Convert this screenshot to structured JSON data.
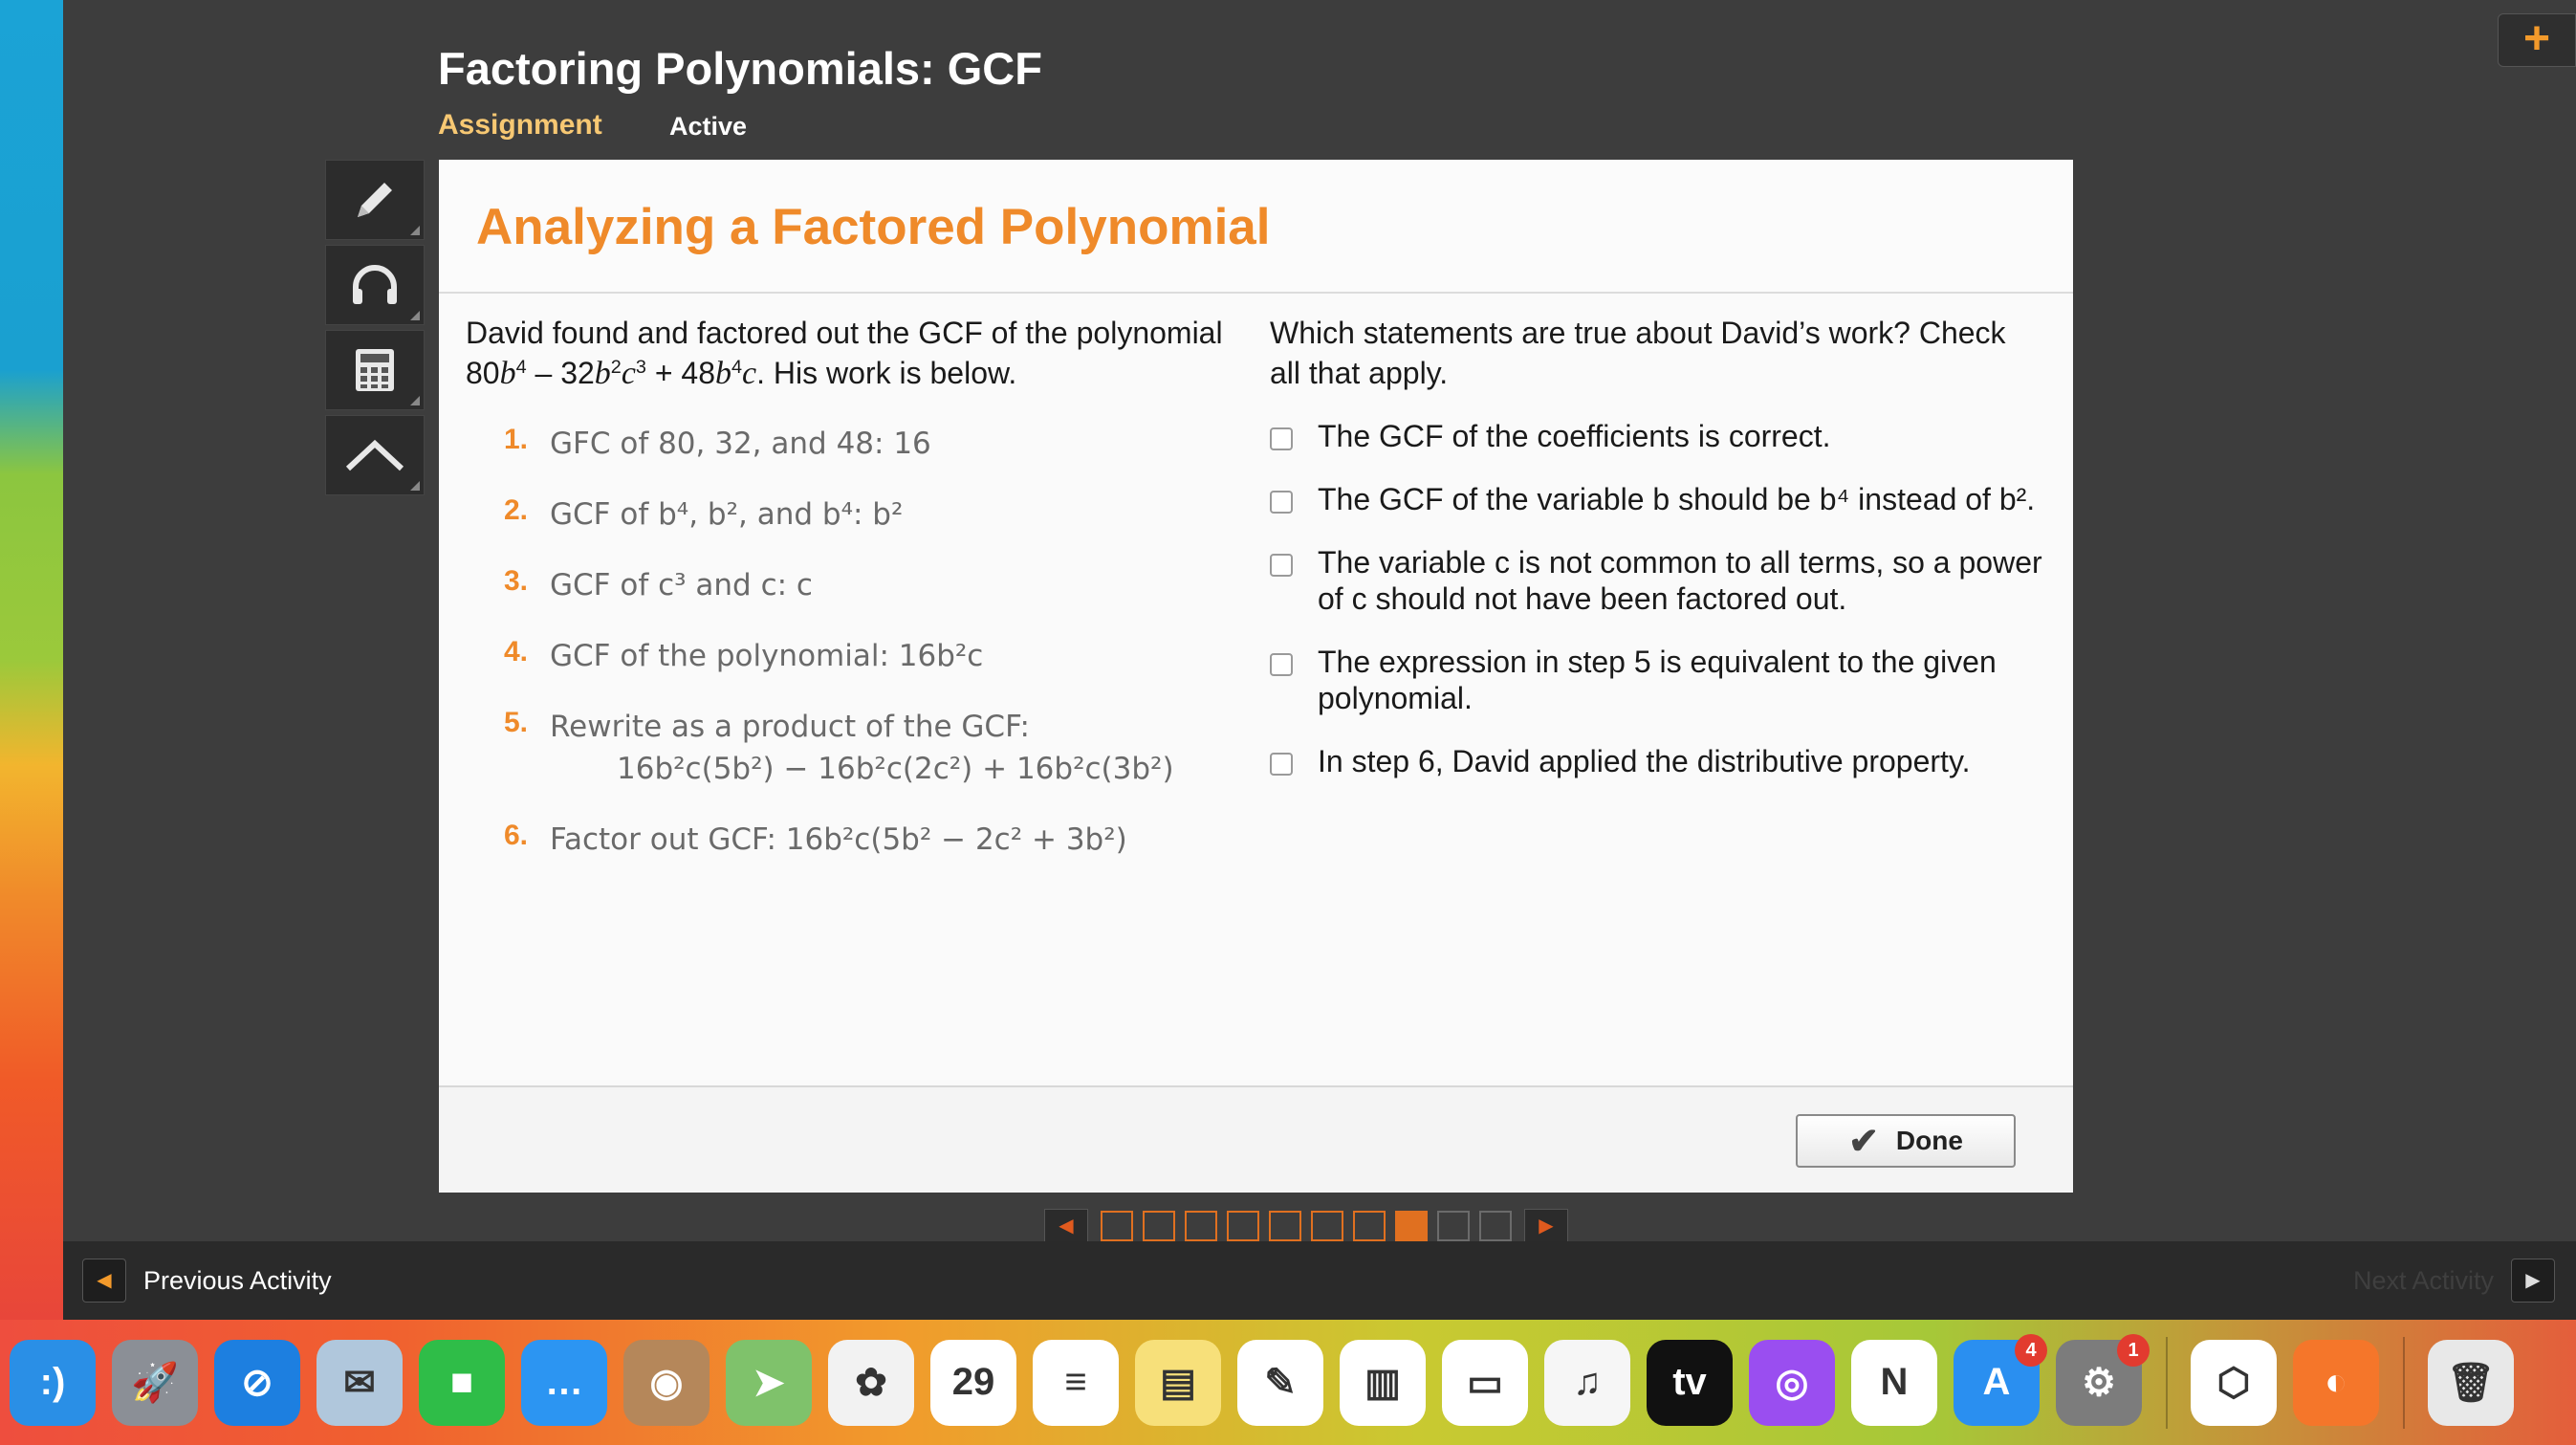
{
  "header": {
    "course_title": "Factoring Polynomials: GCF",
    "assignment_label": "Assignment",
    "status": "Active",
    "plus_label": "+"
  },
  "tools": [
    {
      "name": "pencil-icon"
    },
    {
      "name": "headphones-icon"
    },
    {
      "name": "calculator-icon"
    },
    {
      "name": "caret-up-icon"
    }
  ],
  "activity": {
    "title": "Analyzing a Factored Polynomial",
    "prompt_lead": "David found and factored out the GCF of the polynomial",
    "prompt_tail": ". His work is below.",
    "steps": [
      {
        "num": "1.",
        "text": "GFC of 80, 32, and 48: 16"
      },
      {
        "num": "2.",
        "text": "GCF of b⁴, b², and b⁴: b²"
      },
      {
        "num": "3.",
        "text": "GCF of c³ and c: c"
      },
      {
        "num": "4.",
        "text": "GCF of the polynomial: 16b²c"
      },
      {
        "num": "5.",
        "text": "Rewrite as a product of the GCF:",
        "sub": "16b²c(5b²) − 16b²c(2c²) + 16b²c(3b²)"
      },
      {
        "num": "6.",
        "text": "Factor out GCF: 16b²c(5b² − 2c² + 3b²)"
      }
    ],
    "question": "Which statements are true about David’s work? Check all that apply.",
    "options": [
      "The GCF of the coefficients is correct.",
      "The GCF of the variable b should be b⁴ instead of b².",
      "The variable c is not common to all terms, so a power of c should not have been factored out.",
      "The expression in step 5 is equivalent to the given polynomial.",
      "In step 6, David applied the distributive property."
    ],
    "done_label": "Done"
  },
  "pager": {
    "total": 10,
    "current": 8
  },
  "bottom_nav": {
    "previous_label": "Previous Activity",
    "next_label": "Next Activity"
  },
  "dock": [
    {
      "name": "finder-icon",
      "color": "#2a8fe6",
      "glyph": ":)"
    },
    {
      "name": "launchpad-icon",
      "color": "#8b8f96",
      "glyph": "🚀"
    },
    {
      "name": "safari-icon",
      "color": "#1d7fe0",
      "glyph": "⊘"
    },
    {
      "name": "mail-icon",
      "color": "#b0c7dc",
      "glyph": "✉"
    },
    {
      "name": "facetime-icon",
      "color": "#2fbd48",
      "glyph": "■"
    },
    {
      "name": "messages-icon",
      "color": "#2c95f2",
      "glyph": "…"
    },
    {
      "name": "contacts-icon",
      "color": "#b5875a",
      "glyph": "◉"
    },
    {
      "name": "maps-icon",
      "color": "#7fc26b",
      "glyph": "➤"
    },
    {
      "name": "photos-icon",
      "color": "#f2f2f2",
      "glyph": "✿"
    },
    {
      "name": "calendar-icon",
      "color": "#ffffff",
      "glyph": "29"
    },
    {
      "name": "reminders-icon",
      "color": "#ffffff",
      "glyph": "≡"
    },
    {
      "name": "notes-icon",
      "color": "#f7e07a",
      "glyph": "▤"
    },
    {
      "name": "pages-icon",
      "color": "#ffffff",
      "glyph": "✎"
    },
    {
      "name": "numbers-icon",
      "color": "#ffffff",
      "glyph": "▥"
    },
    {
      "name": "keynote-icon",
      "color": "#ffffff",
      "glyph": "▭"
    },
    {
      "name": "music-icon",
      "color": "#f6f6f6",
      "glyph": "♫"
    },
    {
      "name": "appletv-icon",
      "color": "#111111",
      "glyph": "tv"
    },
    {
      "name": "podcasts-icon",
      "color": "#9a4ef0",
      "glyph": "◎"
    },
    {
      "name": "news-icon",
      "color": "#ffffff",
      "glyph": "N"
    },
    {
      "name": "appstore-icon",
      "color": "#2a8ff0",
      "glyph": "A",
      "badge": "4"
    },
    {
      "name": "system-preferences-icon",
      "color": "#7c7c7c",
      "glyph": "⚙",
      "badge": "1"
    },
    {
      "name": "app-hexagon-icon",
      "color": "#ffffff",
      "glyph": "⬡"
    },
    {
      "name": "firefox-icon",
      "color": "#f5762a",
      "glyph": "◐"
    },
    {
      "name": "trash-icon",
      "color": "#e8e8e8",
      "glyph": "🗑"
    }
  ]
}
